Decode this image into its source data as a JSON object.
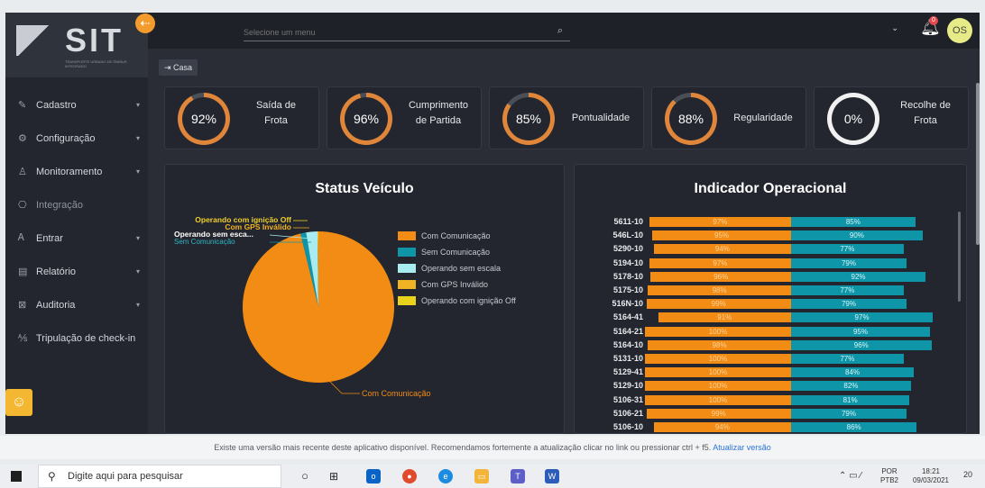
{
  "app": {
    "logo_text": "SIT",
    "logo_subtext": "TRANSPORTE URBANO DE ÔNIBUS INTEGRADO"
  },
  "sidebar": {
    "items": [
      {
        "label": "Cadastro",
        "icon": "edit-icon"
      },
      {
        "label": "Configuração",
        "icon": "gear-icon"
      },
      {
        "label": "Monitoramento",
        "icon": "user-icon"
      },
      {
        "label": "Integração",
        "icon": "integration-icon"
      },
      {
        "label": "Entrar",
        "icon": "login-icon"
      },
      {
        "label": "Relatório",
        "icon": "report-icon"
      },
      {
        "label": "Auditoria",
        "icon": "audit-icon"
      },
      {
        "label": "Tripulação de check-in",
        "icon": "crew-icon"
      }
    ]
  },
  "topbar": {
    "search_placeholder": "Selecione um menu",
    "notification_count": "0",
    "avatar_initials": "OS"
  },
  "breadcrumb": {
    "label": "Casa"
  },
  "kpis": [
    {
      "value": "92%",
      "label_line1": "Saída de",
      "label_line2": "Frota",
      "percent": 92,
      "color": "#e0863a"
    },
    {
      "value": "96%",
      "label_line1": "Cumprimento",
      "label_line2": "de Partida",
      "percent": 96,
      "color": "#e0863a"
    },
    {
      "value": "85%",
      "label_line1": "Pontualidade",
      "label_line2": "",
      "percent": 85,
      "color": "#e0863a"
    },
    {
      "value": "88%",
      "label_line1": "Regularidade",
      "label_line2": "",
      "percent": 88,
      "color": "#e0863a"
    },
    {
      "value": "0%",
      "label_line1": "Recolhe de",
      "label_line2": "Frota",
      "percent": 0,
      "color": "#ffffff"
    }
  ],
  "status_panel": {
    "title": "Status Veículo",
    "legend": [
      {
        "label": "Com Comunicação",
        "color": "#f28c14"
      },
      {
        "label": "Sem Comunicação",
        "color": "#0e96a8"
      },
      {
        "label": "Operando sem escala",
        "color": "#a8ecf2"
      },
      {
        "label": "Com GPS Inválido",
        "color": "#f0b323"
      },
      {
        "label": "Operando com ignição Off",
        "color": "#e8d21c"
      }
    ],
    "callouts": {
      "ignicao": "Operando com ignição Off",
      "gps": "Com GPS Inválido",
      "sem_escala": "Operando sem esca...",
      "sem_comunicacao": "Sem Comunicação",
      "com_comunicacao": "Com Comunicação"
    }
  },
  "chart_data": {
    "type": "bar",
    "title": "Indicador Operacional",
    "categories": [
      "5611-10",
      "546L-10",
      "5290-10",
      "5194-10",
      "5178-10",
      "5175-10",
      "516N-10",
      "5164-41",
      "5164-21",
      "5164-10",
      "5131-10",
      "5129-41",
      "5129-10",
      "5106-31",
      "5106-21",
      "5106-10"
    ],
    "series": [
      {
        "values": [
          97,
          95,
          94,
          97,
          96,
          98,
          99,
          91,
          100,
          98,
          100,
          100,
          100,
          100,
          99,
          94
        ],
        "color": "#f28c14"
      },
      {
        "values": [
          85,
          90,
          77,
          79,
          92,
          77,
          79,
          97,
          95,
          96,
          77,
          84,
          82,
          81,
          79,
          86
        ],
        "color": "#0e96a8"
      }
    ]
  },
  "pie_data": {
    "type": "pie",
    "slices": [
      {
        "name": "Com Comunicação",
        "value": 96.2,
        "color": "#f28c14"
      },
      {
        "name": "Sem Comunicação",
        "value": 1.2,
        "color": "#0e96a8"
      },
      {
        "name": "Operando sem escala",
        "value": 2.4,
        "color": "#a8ecf2"
      },
      {
        "name": "Com GPS Inválido",
        "value": 0.1,
        "color": "#f0b323"
      },
      {
        "name": "Operando com ignição Off",
        "value": 0.1,
        "color": "#e8d21c"
      }
    ]
  },
  "notice": {
    "text": "Existe uma versão mais recente deste aplicativo disponível. Recomendamos fortemente a atualização clicar no link ou pressionar ctrl + f5.",
    "link": "Atualizar versão"
  },
  "taskbar": {
    "search_placeholder": "Digite aqui para pesquisar",
    "lang_line1": "POR",
    "lang_line2": "PTB2",
    "time": "18:21",
    "date": "09/03/2021",
    "notif_count": "20"
  }
}
